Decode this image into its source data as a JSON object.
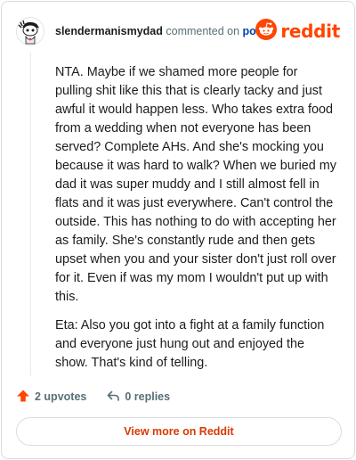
{
  "header": {
    "username": "slendermanismydad",
    "commented_on": "commented on",
    "post_link": "post",
    "brand": "reddit",
    "avatar_icon": "snoo-avatar-icon",
    "brand_icon": "reddit-logo-icon",
    "brand_color": "#ff4500"
  },
  "comment": {
    "paragraphs": [
      "NTA. Maybe if we shamed more people for pulling shit like this that is clearly tacky and just awful it would happen less. Who takes extra food from a wedding when not everyone has been served? Complete AHs. And she's mocking you because it was hard to walk? When we buried my dad it was super muddy and I still almost fell in flats and it was just everywhere. Can't control the outside. This has nothing to do with accepting her as family. She's constantly rude and then gets upset when you and your sister don't just roll over for it. Even if was my mom I wouldn't put up with this.",
      "Eta: Also you got into a fight at a family function and everyone just hung out and enjoyed the show. That's kind of telling."
    ]
  },
  "actions": {
    "upvotes": "2 upvotes",
    "replies": "0 replies",
    "upvote_icon": "upvote-arrow-icon",
    "reply_icon": "reply-arrow-icon",
    "upvote_color": "#ff4500"
  },
  "footer": {
    "view_more": "View more on Reddit",
    "link_color": "#d93a00"
  }
}
